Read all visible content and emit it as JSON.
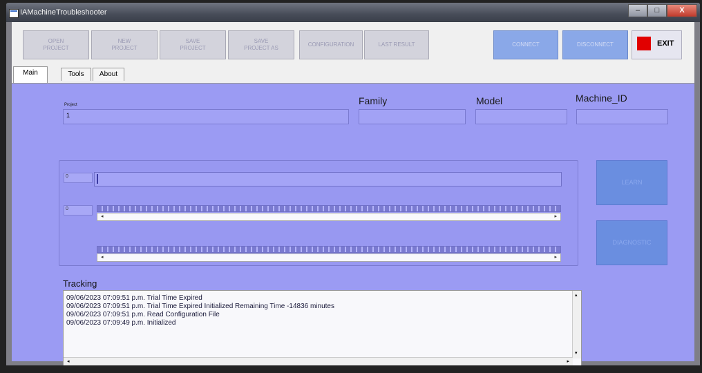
{
  "window": {
    "title": "IAMachineTroubleshooter",
    "controls": [
      "–",
      "□",
      "X"
    ]
  },
  "toolbar": {
    "open_project": "OPEN\nPROJECT",
    "new_project": "NEW\nPROJECT",
    "save_project": "SAVE\nPROJECT",
    "save_project_as": "SAVE\nPROJECT AS",
    "configuration": "CONFIGURATION",
    "last_result": "LAST RESULT",
    "connect": "CONNECT",
    "disconnect": "DISCONNECT",
    "exit": "EXIT"
  },
  "tabs": {
    "main": "Main",
    "tools": "Tools",
    "about": "About"
  },
  "fields": {
    "project_label": "Project",
    "project_value": "1",
    "family_label": "Family",
    "family_value": "",
    "model_label": "Model",
    "model_value": "",
    "machine_id_label": "Machine_ID",
    "machine_id_value": ""
  },
  "group": {
    "box1": "0",
    "box2": "0"
  },
  "buttons": {
    "learn": "LEARN",
    "diagnostic": "DIAGNOSTIC"
  },
  "tracking": {
    "label": "Tracking",
    "lines": [
      "09/06/2023 07:09:51 p.m.   Trial Time Expired",
      "09/06/2023 07:09:51 p.m.   Trial Time Expired Initialized Remaining Time -14836 minutes",
      "09/06/2023 07:09:51 p.m.   Read Configuration File",
      "09/06/2023 07:09:49 p.m.   Initialized"
    ]
  },
  "colors": {
    "panel": "#9b9bf3",
    "exit_square": "#e10000",
    "connect_btn": "#8aa8e8"
  }
}
